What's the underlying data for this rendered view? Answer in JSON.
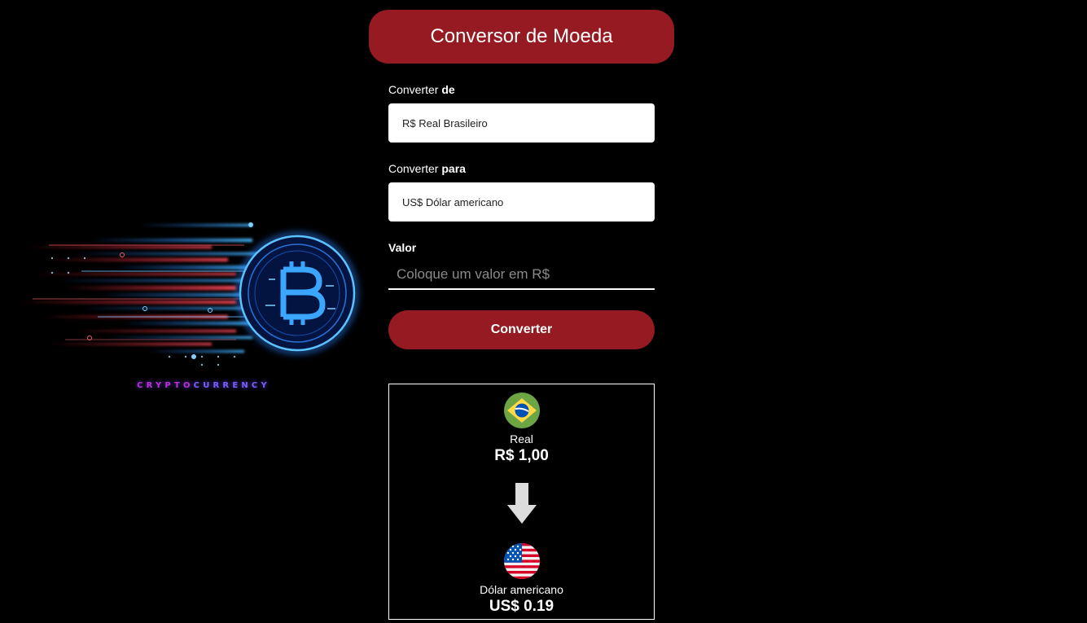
{
  "app": {
    "title": "Conversor de Moeda"
  },
  "illustration": {
    "caption_part1": "CRYPTO",
    "caption_part2": "CURRENCY",
    "coin_icon": "bitcoin-icon"
  },
  "form": {
    "from": {
      "label_prefix": "Converter ",
      "label_bold": "de",
      "selected": "R$ Real Brasileiro"
    },
    "to": {
      "label_prefix": "Converter ",
      "label_bold": "para",
      "selected": "US$ Dólar americano"
    },
    "amount": {
      "label": "Valor",
      "value": "",
      "placeholder": "Coloque um valor em R$"
    },
    "convert_label": "Converter"
  },
  "result": {
    "from": {
      "flag_icon": "brazil-flag-icon",
      "name": "Real",
      "value": "R$ 1,00"
    },
    "arrow_icon": "arrow-down-icon",
    "to": {
      "flag_icon": "usa-flag-icon",
      "name": "Dólar americano",
      "value": "US$ 0.19"
    }
  },
  "colors": {
    "background": "#000000",
    "accent": "#951a21",
    "text": "#ffffff",
    "input_background": "#ffffff"
  }
}
